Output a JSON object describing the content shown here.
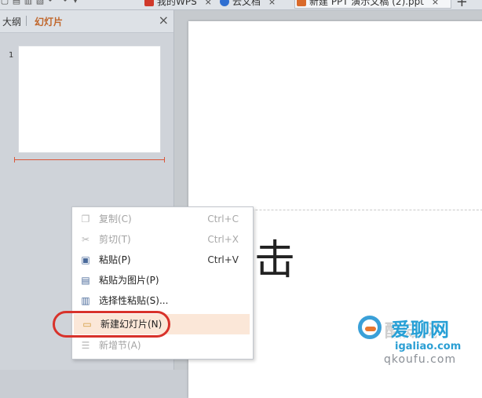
{
  "titlebar": {
    "tabs": [
      {
        "label": "我的WPS",
        "close": "×",
        "icon_color": "#d0392b"
      },
      {
        "label": "云文档",
        "close": "×",
        "icon_color": "#2f6fd1"
      },
      {
        "label": "新建 PPT 演示文稿 (2).ppt",
        "close": "×",
        "icon_color": "#d96a2b"
      }
    ],
    "new_tab": "+"
  },
  "left_pane": {
    "tabs": [
      {
        "label": "大纲"
      },
      {
        "label": "幻灯片"
      }
    ],
    "close": "×",
    "slide_number": "1"
  },
  "slide": {
    "title_placeholder": "单击"
  },
  "context_menu": {
    "items": [
      {
        "label": "复制(C)",
        "shortcut": "Ctrl+C",
        "icon": "copy-icon",
        "disabled": true
      },
      {
        "label": "剪切(T)",
        "shortcut": "Ctrl+X",
        "icon": "scissors-icon",
        "disabled": true
      },
      {
        "label": "粘贴(P)",
        "shortcut": "Ctrl+V",
        "icon": "paste-icon",
        "disabled": false
      },
      {
        "label": "粘贴为图片(P)",
        "shortcut": "",
        "icon": "paste-picture-icon",
        "disabled": false
      },
      {
        "label": "选择性粘贴(S)...",
        "shortcut": "",
        "icon": "paste-special-icon",
        "disabled": false
      },
      {
        "label": "新建幻灯片(N)",
        "shortcut": "",
        "icon": "new-slide-icon",
        "disabled": false,
        "highlighted": true
      },
      {
        "label": "新增节(A)",
        "shortcut": "",
        "icon": "new-section-icon",
        "disabled": true
      }
    ]
  },
  "watermark": {
    "text": "爱聊网",
    "faint_text": "酷知网",
    "url": "igaliao.com",
    "url2": "qkoufu.com"
  },
  "colors": {
    "accent_tab": "#c0662b",
    "highlight": "#fbe7d8",
    "annotation_circle": "#d8322b"
  }
}
